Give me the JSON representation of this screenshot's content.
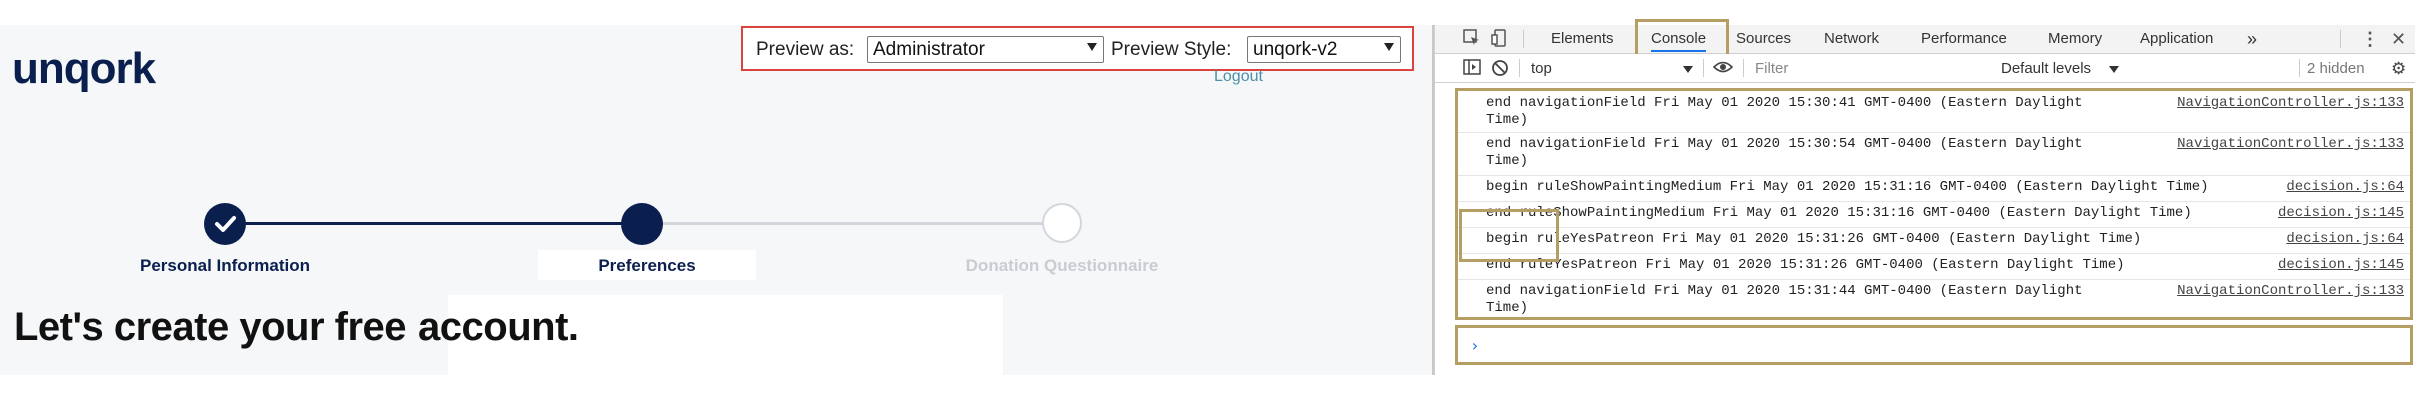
{
  "app": {
    "logo": "unqork",
    "preview": {
      "as_label": "Preview as:",
      "as_value": "Administrator",
      "style_label": "Preview Style:",
      "style_value": "unqork-v2"
    },
    "logout": "Logout",
    "stepper": [
      {
        "label": "Personal Information",
        "state": "complete"
      },
      {
        "label": "Preferences",
        "state": "current"
      },
      {
        "label": "Donation Questionnaire",
        "state": "upcoming"
      }
    ],
    "headline_part1": "Let's create your free",
    "headline_part2": "account."
  },
  "devtools": {
    "tabs": [
      "Elements",
      "Console",
      "Sources",
      "Network",
      "Performance",
      "Memory",
      "Application"
    ],
    "active_tab": "Console",
    "more_tabs": "»",
    "context": "top",
    "filter_placeholder": "Filter",
    "levels": "Default levels",
    "hidden_count": "2 hidden",
    "prompt": "›",
    "logs": [
      {
        "line1": "end navigationField Fri May 01 2020 15:30:41 GMT-0400 (Eastern Daylight",
        "line2": "Time)",
        "source": "NavigationController.js:133"
      },
      {
        "line1": "end navigationField Fri May 01 2020 15:30:54 GMT-0400 (Eastern Daylight",
        "line2": "Time)",
        "source": "NavigationController.js:133"
      },
      {
        "line1": "begin ruleShowPaintingMedium Fri May 01 2020 15:31:16 GMT-0400 (Eastern Daylight Time)",
        "line2": "",
        "source": "decision.js:64"
      },
      {
        "line1": "end ruleShowPaintingMedium Fri May 01 2020 15:31:16 GMT-0400 (Eastern Daylight Time)",
        "line2": "",
        "source": "decision.js:145"
      },
      {
        "line1": "begin ruleYesPatreon Fri May 01 2020 15:31:26 GMT-0400 (Eastern Daylight Time)",
        "line2": "",
        "source": "decision.js:64"
      },
      {
        "line1": "end ruleYesPatreon Fri May 01 2020 15:31:26 GMT-0400 (Eastern Daylight Time)",
        "line2": "",
        "source": "decision.js:145"
      },
      {
        "line1": "end navigationField Fri May 01 2020 15:31:44 GMT-0400 (Eastern Daylight",
        "line2": "Time)",
        "source": "NavigationController.js:133"
      }
    ]
  },
  "colors": {
    "brand_navy": "#0b1f4f",
    "highlight_red": "#d9453e",
    "highlight_gold": "#b49e63",
    "link_teal": "#4d8fa8"
  }
}
